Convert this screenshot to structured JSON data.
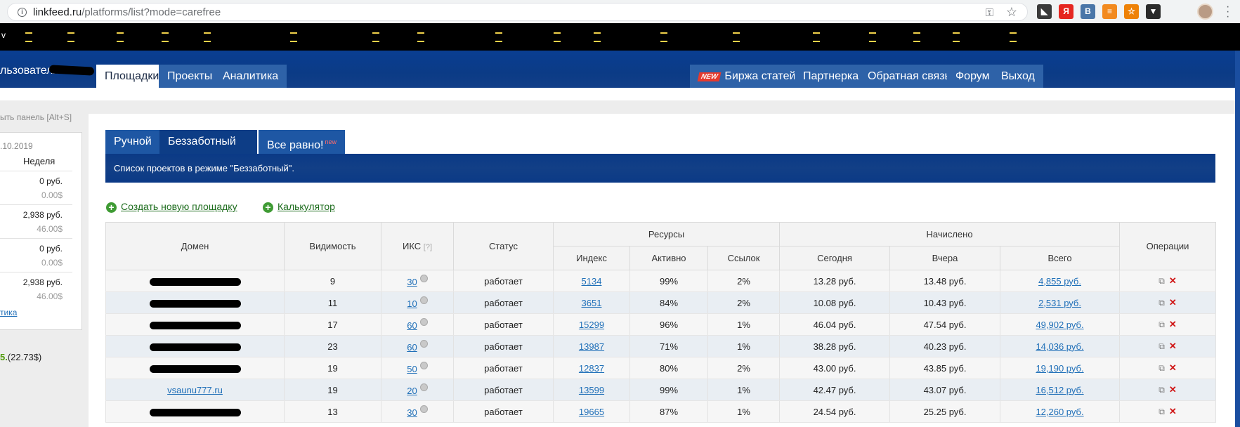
{
  "browser": {
    "url_host": "linkfeed.ru",
    "url_path": "/platforms/list?mode=carefree",
    "extensions": [
      {
        "name": "ext-1",
        "glyph": "◣",
        "color": "#3a3a3a"
      },
      {
        "name": "ext-yandex",
        "glyph": "Я",
        "color": "#e52620"
      },
      {
        "name": "ext-vk",
        "glyph": "B",
        "color": "#4a76a8"
      },
      {
        "name": "ext-rss",
        "glyph": "≡",
        "color": "#f28a1f"
      },
      {
        "name": "ext-ok",
        "glyph": "☆",
        "color": "#ee8208"
      },
      {
        "name": "ext-shield",
        "glyph": "▼",
        "color": "#2b2b2b"
      }
    ]
  },
  "bookmarks_bar": {
    "label": "v"
  },
  "header": {
    "user_label": "льзователя",
    "left_tabs": [
      "Площадки",
      "Проекты",
      "Аналитика"
    ],
    "new_badge": "NEW",
    "right_tabs": [
      "Биржа статей",
      "Партнерка",
      "Обратная связь",
      "Форум",
      "Выход"
    ]
  },
  "left_panel": {
    "hint": "ыть панель [Alt+S]",
    "date": ".10.2019",
    "period": "Неделя",
    "rows": [
      {
        "rub": "0 руб.",
        "usd": "0.00$"
      },
      {
        "rub": "2,938 руб.",
        "usd": "46.00$"
      },
      {
        "rub": "0 руб.",
        "usd": "0.00$"
      },
      {
        "rub": "2,938 руб.",
        "usd": "46.00$"
      }
    ],
    "link": "тика",
    "balance_main": "5.",
    "balance_usd": "(22.73$)"
  },
  "main": {
    "mode_tabs": [
      {
        "label": "Ручной",
        "sup": ""
      },
      {
        "label": "Беззаботный",
        "sup": ""
      },
      {
        "label": "Все равно!",
        "sup": "new"
      }
    ],
    "banner": "Список проектов в режиме \"Беззаботный\".",
    "actions": [
      "Создать новую площадку",
      "Калькулятор"
    ],
    "table": {
      "headers": {
        "domain": "Домен",
        "visibility": "Видимость",
        "iks": "ИКС",
        "iks_hint": "[?]",
        "status": "Статус",
        "resources": "Ресурсы",
        "accrued": "Начислено",
        "operations": "Операции",
        "index": "Индекс",
        "active": "Активно",
        "links": "Ссылок",
        "today": "Сегодня",
        "yesterday": "Вчера",
        "total": "Всего"
      },
      "rows": [
        {
          "domain": "",
          "visibility": "9",
          "iks": "30",
          "status": "работает",
          "index": "5134",
          "active": "99%",
          "links": "2%",
          "today": "13.28 руб.",
          "yesterday": "13.48 руб.",
          "total": "4,855 руб."
        },
        {
          "domain": "",
          "visibility": "11",
          "iks": "10",
          "status": "работает",
          "index": "3651",
          "active": "84%",
          "links": "2%",
          "today": "10.08 руб.",
          "yesterday": "10.43 руб.",
          "total": "2,531 руб."
        },
        {
          "domain": "",
          "visibility": "17",
          "iks": "60",
          "status": "работает",
          "index": "15299",
          "active": "96%",
          "links": "1%",
          "today": "46.04 руб.",
          "yesterday": "47.54 руб.",
          "total": "49,902 руб."
        },
        {
          "domain": "",
          "visibility": "23",
          "iks": "60",
          "status": "работает",
          "index": "13987",
          "active": "71%",
          "links": "1%",
          "today": "38.28 руб.",
          "yesterday": "40.23 руб.",
          "total": "14,036 руб."
        },
        {
          "domain": "",
          "visibility": "19",
          "iks": "50",
          "status": "работает",
          "index": "12837",
          "active": "80%",
          "links": "2%",
          "today": "43.00 руб.",
          "yesterday": "43.85 руб.",
          "total": "19,190 руб."
        },
        {
          "domain": "vsaunu777.ru",
          "visibility": "19",
          "iks": "20",
          "status": "работает",
          "index": "13599",
          "active": "99%",
          "links": "1%",
          "today": "42.47 руб.",
          "yesterday": "43.07 руб.",
          "total": "16,512 руб."
        },
        {
          "domain": "",
          "visibility": "13",
          "iks": "30",
          "status": "работает",
          "index": "19665",
          "active": "87%",
          "links": "1%",
          "today": "24.54 руб.",
          "yesterday": "25.25 руб.",
          "total": "12,260 руб."
        }
      ]
    }
  }
}
